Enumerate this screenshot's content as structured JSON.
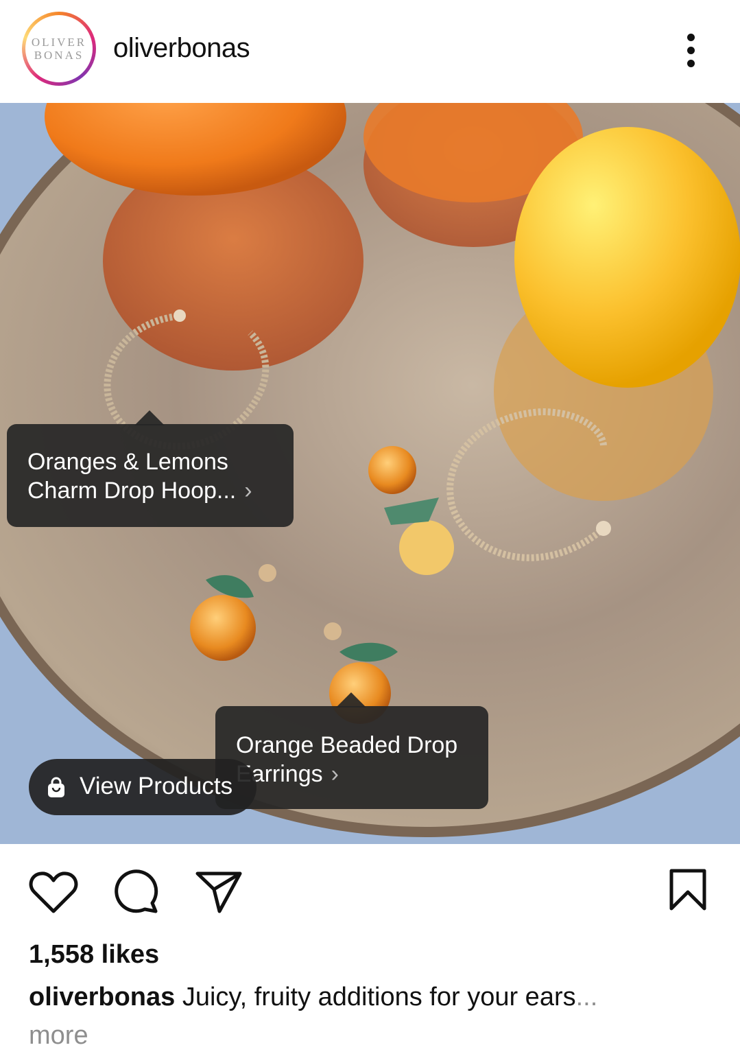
{
  "header": {
    "avatar_line1": "OLIVER",
    "avatar_line2": "BONAS",
    "username": "oliverbonas",
    "more_icon": "more-vertical-icon"
  },
  "photo": {
    "tags": [
      {
        "line1": "Oranges & Lemons",
        "line2": "Charm Drop Hoop..."
      },
      {
        "line1": "Orange Beaded Drop",
        "line2": "Earrings"
      }
    ],
    "view_products_label": "View Products",
    "view_products_icon": "shopping-bag-icon"
  },
  "actions": {
    "like_icon": "heart-icon",
    "comment_icon": "comment-icon",
    "share_icon": "send-icon",
    "save_icon": "bookmark-icon"
  },
  "post": {
    "likes": "1,558 likes",
    "caption_user": "oliverbonas",
    "caption_text": " Juicy, fruity additions for your ears",
    "caption_ellipsis": "...",
    "more_label": "more"
  }
}
